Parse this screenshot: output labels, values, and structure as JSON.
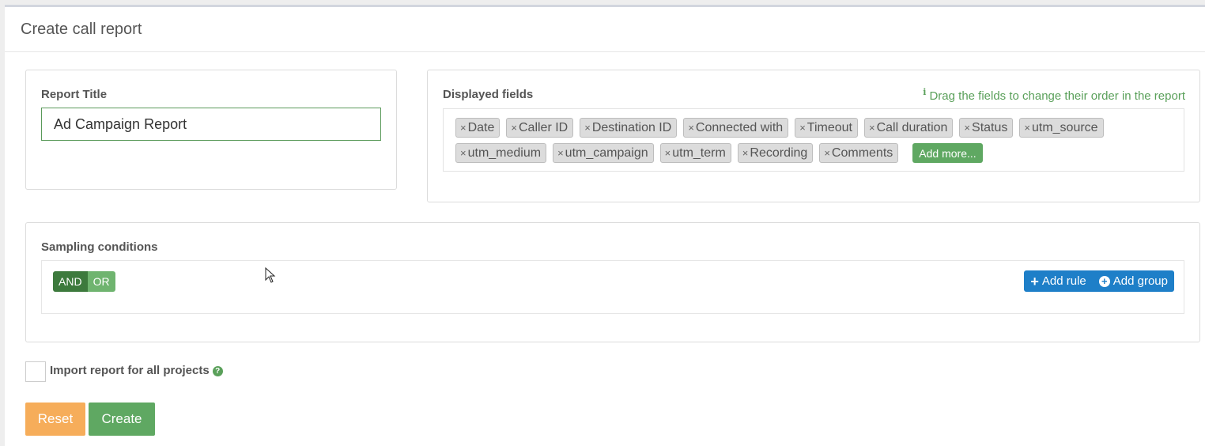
{
  "page": {
    "title": "Create call report"
  },
  "report_title": {
    "label": "Report Title",
    "value": "Ad Campaign Report"
  },
  "displayed_fields": {
    "label": "Displayed fields",
    "hint": "Drag the fields to change their order in the report",
    "hint_icon": "info-icon",
    "remove_glyph": "×",
    "tags_row1": [
      "Date",
      "Caller ID",
      "Destination ID",
      "Connected with",
      "Timeout",
      "Call duration",
      "Status",
      "utm_source"
    ],
    "tags_row2": [
      "utm_medium",
      "utm_campaign",
      "utm_term",
      "Recording",
      "Comments"
    ],
    "add_more_label": "Add more..."
  },
  "sampling": {
    "label": "Sampling conditions",
    "and_label": "AND",
    "or_label": "OR",
    "selected": "AND",
    "add_rule_label": "Add rule",
    "add_group_label": "Add group"
  },
  "import": {
    "label": "Import report for all projects",
    "checked": false,
    "help_icon": "question-icon"
  },
  "buttons": {
    "reset_label": "Reset",
    "create_label": "Create"
  },
  "colors": {
    "green": "#5fa862",
    "dark_green": "#3d7a3d",
    "blue": "#1e7fc8",
    "orange": "#f6ad5a"
  }
}
